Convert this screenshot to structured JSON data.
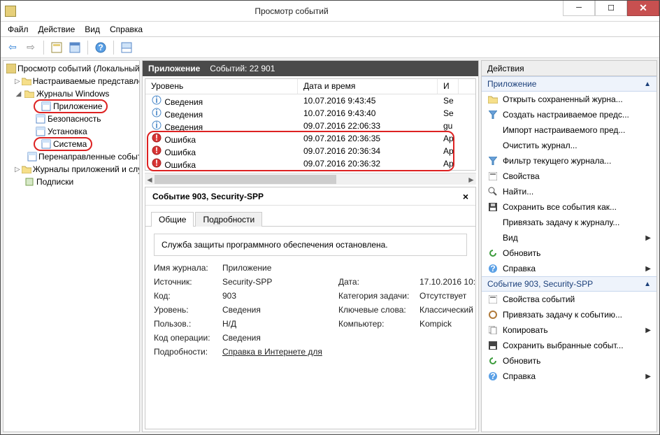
{
  "window": {
    "title": "Просмотр событий"
  },
  "menu": {
    "file": "Файл",
    "action": "Действие",
    "view": "Вид",
    "help": "Справка"
  },
  "tree": {
    "root": "Просмотр событий (Локальный",
    "custom": "Настраиваемые представления",
    "wlogs": "Журналы Windows",
    "app": "Приложение",
    "sec": "Безопасность",
    "setup": "Установка",
    "system": "Система",
    "fwd": "Перенаправленные события",
    "applogs": "Журналы приложений и служб",
    "subs": "Подписки"
  },
  "mid": {
    "section": "Приложение",
    "count_label": "Событий: 22 901"
  },
  "columns": {
    "level": "Уровень",
    "date": "Дата и время",
    "src": "И"
  },
  "rows": [
    {
      "icon": "info",
      "level": "Сведения",
      "date": "10.07.2016 9:43:45",
      "src": "Se"
    },
    {
      "icon": "info",
      "level": "Сведения",
      "date": "10.07.2016 9:43:40",
      "src": "Se"
    },
    {
      "icon": "info",
      "level": "Сведения",
      "date": "09.07.2016 22:06:33",
      "src": "gu"
    },
    {
      "icon": "error",
      "level": "Ошибка",
      "date": "09.07.2016 20:36:35",
      "src": "Ap"
    },
    {
      "icon": "error",
      "level": "Ошибка",
      "date": "09.07.2016 20:36:34",
      "src": "Ap"
    },
    {
      "icon": "error",
      "level": "Ошибка",
      "date": "09.07.2016 20:36:32",
      "src": "Ap"
    }
  ],
  "detail": {
    "title": "Событие 903, Security-SPP",
    "tab_general": "Общие",
    "tab_details": "Подробности",
    "message": "Служба защиты программного обеспечения остановлена.",
    "k_log": "Имя журнала:",
    "v_log": "Приложение",
    "k_source": "Источник:",
    "v_source": "Security-SPP",
    "k_date": "Дата:",
    "v_date": "17.10.2016 10:4",
    "k_code": "Код:",
    "v_code": "903",
    "k_cat": "Категория задачи:",
    "v_cat": "Отсутствует",
    "k_level": "Уровень:",
    "v_level": "Сведения",
    "k_key": "Ключевые слова:",
    "v_key": "Классический",
    "k_user": "Пользов.:",
    "v_user": "Н/Д",
    "k_comp": "Компьютер:",
    "v_comp": "Kompick",
    "k_op": "Код операции:",
    "v_op": "Сведения",
    "k_more": "Подробности:",
    "v_more": "Справка в Интернете для"
  },
  "actions": {
    "header": "Действия",
    "section_app": "Приложение",
    "open": "Открыть сохраненный журна...",
    "create": "Создать настраиваемое предс...",
    "import": "Импорт настраиваемого пред...",
    "clear": "Очистить журнал...",
    "filter": "Фильтр текущего журнала...",
    "props": "Свойства",
    "find": "Найти...",
    "saveall": "Сохранить все события как...",
    "attach": "Привязать задачу к журналу...",
    "view": "Вид",
    "refresh": "Обновить",
    "help": "Справка",
    "section_evt": "Событие 903, Security-SPP",
    "evt_props": "Свойства событий",
    "evt_attach": "Привязать задачу к событию...",
    "copy": "Копировать",
    "savesel": "Сохранить выбранные событ...",
    "refresh2": "Обновить",
    "help2": "Справка"
  }
}
